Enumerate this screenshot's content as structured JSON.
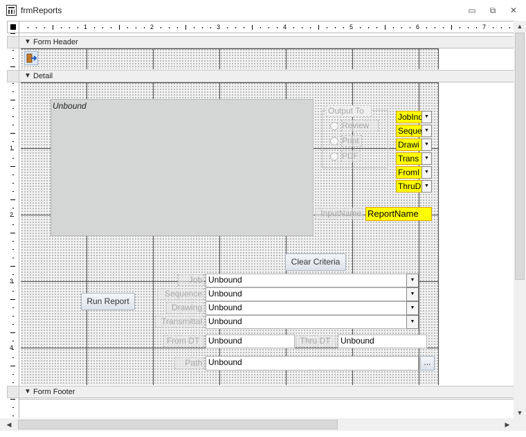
{
  "window": {
    "title": "frmReports",
    "minimize_glyph": "▭",
    "restore_glyph": "⧉",
    "close_glyph": "✕"
  },
  "ruler": {
    "marks": [
      "1",
      "2",
      "3",
      "4",
      "5",
      "6",
      "7"
    ],
    "vmarks": [
      "1",
      "2",
      "3",
      "4"
    ]
  },
  "sections": {
    "header": "Form Header",
    "detail": "Detail",
    "footer": "Form Footer"
  },
  "detail": {
    "subform_label": "Unbound",
    "output_group_label": "Output To",
    "output_options": [
      "Review",
      "Print",
      "PDF"
    ],
    "yellow_combos": [
      "JobInd",
      "Seque",
      "Drawi",
      "Trans",
      "FromI",
      "ThruD"
    ],
    "report_name_label": "InputName",
    "report_name_value": "ReportName",
    "clear_button": "Clear Criteria",
    "run_button": "Run Report",
    "combos": [
      {
        "label": "Job",
        "value": "Unbound"
      },
      {
        "label": "Sequence",
        "value": "Unbound"
      },
      {
        "label": "Drawing",
        "value": "Unbound"
      },
      {
        "label": "Transmittal",
        "value": "Unbound"
      }
    ],
    "from_dt_label": "From DT",
    "from_dt_value": "Unbound",
    "thru_dt_label": "Thru DT",
    "thru_dt_value": "Unbound",
    "path_label": "Path",
    "path_value": "Unbound",
    "browse_button": "..."
  },
  "icons": {
    "exit_button": "exit-door-icon",
    "dropdown": "chevron-down-icon"
  },
  "colors": {
    "highlight": "#ffff00",
    "subform": "#d4d5d5",
    "grid_background": "#f2f2f2"
  }
}
